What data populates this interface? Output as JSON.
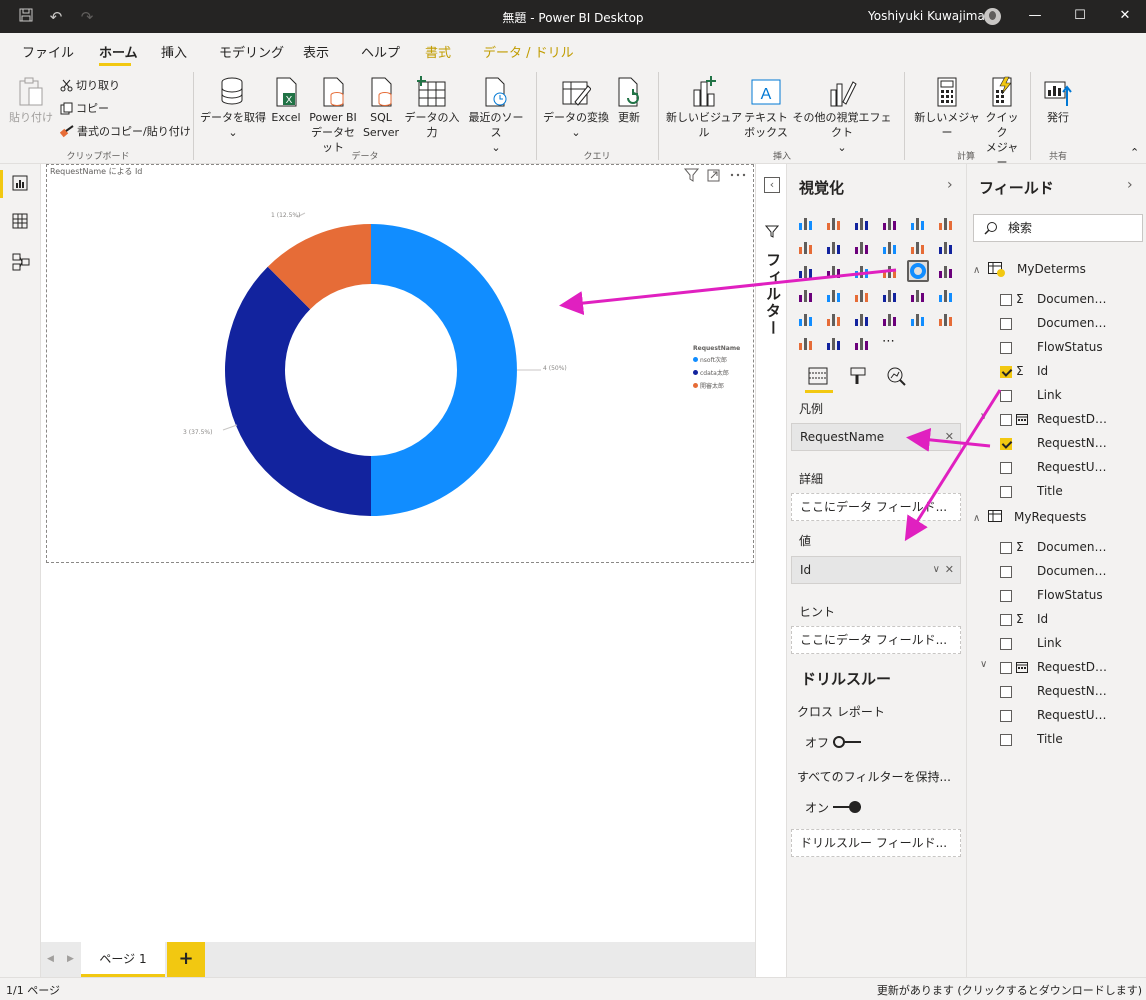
{
  "window": {
    "title": "無題 - Power BI Desktop",
    "user": "Yoshiyuki Kuwajima"
  },
  "menu_tabs": [
    {
      "label": "ファイル",
      "state": "normal"
    },
    {
      "label": "ホーム",
      "state": "active"
    },
    {
      "label": "挿入",
      "state": "normal"
    },
    {
      "label": "モデリング",
      "state": "normal"
    },
    {
      "label": "表示",
      "state": "normal"
    },
    {
      "label": "ヘルプ",
      "state": "normal"
    },
    {
      "label": "書式",
      "state": "context"
    },
    {
      "label": "データ / ドリル",
      "state": "context"
    }
  ],
  "ribbon": {
    "clipboard": {
      "paste": "貼り付け",
      "cut": "切り取り",
      "copy": "コピー",
      "format_painter": "書式のコピー/貼り付け",
      "group": "クリップボード"
    },
    "data": {
      "get_data": "データを取得",
      "excel": "Excel",
      "pbi_1": "Power BI",
      "pbi_2": "データセット",
      "sql_1": "SQL",
      "sql_2": "Server",
      "enter_data": "データの入力",
      "recent": "最近のソース",
      "group": "データ"
    },
    "query": {
      "transform": "データの変換",
      "refresh": "更新",
      "group": "クエリ"
    },
    "insert": {
      "new_visual": "新しいビジュアル",
      "textbox_1": "テキスト",
      "textbox_2": "ボックス",
      "more_visuals": "その他の視覚エフェクト",
      "group": "挿入"
    },
    "calc": {
      "new_measure": "新しいメジャー",
      "quick_1": "クイック",
      "quick_2": "メジャー",
      "group": "計算"
    },
    "share": {
      "publish": "発行",
      "group": "共有"
    }
  },
  "visual": {
    "title": "RequestName による Id",
    "legend_title": "RequestName",
    "legend": [
      {
        "label": "nsoft次郎",
        "color": "#118DFF"
      },
      {
        "label": "cdata太郎",
        "color": "#12239E"
      },
      {
        "label": "開審太郎",
        "color": "#E66C37"
      }
    ],
    "labels": {
      "slice_a": "4 (50%)",
      "slice_b": "3 (37.5%)",
      "slice_c": "1 (12.5%)"
    }
  },
  "chart_data": {
    "type": "pie",
    "categories": [
      "nsoft次郎",
      "cdata太郎",
      "開審太郎"
    ],
    "values": [
      4,
      3,
      1
    ],
    "colors": [
      "#118DFF",
      "#12239E",
      "#E66C37"
    ],
    "title": "RequestName による Id",
    "legend_title": "RequestName",
    "legend_position": "right",
    "donut": true
  },
  "pages": {
    "current": "ページ 1",
    "add": "+"
  },
  "filter_pane": {
    "label": "フィルター"
  },
  "viz_pane": {
    "title": "視覚化",
    "wells": {
      "legend_label": "凡例",
      "legend_value": "RequestName",
      "details_label": "詳細",
      "details_placeholder": "ここにデータ フィールド...",
      "values_label": "値",
      "values_value": "Id",
      "tooltips_label": "ヒント",
      "tooltips_placeholder": "ここにデータ フィールド..."
    },
    "drillthrough": {
      "title": "ドリルスルー",
      "cross_report": "クロス レポート",
      "cross_report_state": "オフ",
      "keep_filters": "すべてのフィルターを保持...",
      "keep_filters_state": "オン",
      "placeholder": "ドリルスルー フィールド..."
    }
  },
  "fields_pane": {
    "title": "フィールド",
    "search_placeholder": "検索",
    "tables": [
      {
        "name": "MyDeterms",
        "fields": [
          {
            "name": "DocumentId",
            "checked": false,
            "type": "sigma"
          },
          {
            "name": "Document...",
            "checked": false,
            "type": "text"
          },
          {
            "name": "FlowStatus",
            "checked": false,
            "type": "text"
          },
          {
            "name": "Id",
            "checked": true,
            "type": "sigma"
          },
          {
            "name": "Link",
            "checked": false,
            "type": "text"
          },
          {
            "name": "RequestDate",
            "checked": false,
            "type": "date"
          },
          {
            "name": "RequestNa...",
            "checked": true,
            "type": "text"
          },
          {
            "name": "RequestUse...",
            "checked": false,
            "type": "text"
          },
          {
            "name": "Title",
            "checked": false,
            "type": "text"
          }
        ]
      },
      {
        "name": "MyRequests",
        "fields": [
          {
            "name": "DocumentId",
            "checked": false,
            "type": "sigma"
          },
          {
            "name": "Document...",
            "checked": false,
            "type": "text"
          },
          {
            "name": "FlowStatus",
            "checked": false,
            "type": "text"
          },
          {
            "name": "Id",
            "checked": false,
            "type": "sigma"
          },
          {
            "name": "Link",
            "checked": false,
            "type": "text"
          },
          {
            "name": "RequestDate",
            "checked": false,
            "type": "date"
          },
          {
            "name": "RequestNa...",
            "checked": false,
            "type": "text"
          },
          {
            "name": "RequestUse...",
            "checked": false,
            "type": "text"
          },
          {
            "name": "Title",
            "checked": false,
            "type": "text"
          }
        ]
      }
    ]
  },
  "status": {
    "pages": "1/1 ページ",
    "update": "更新があります (クリックするとダウンロードします)"
  },
  "colors": {
    "accent": "#F2C811",
    "annotation_arrow": "#E020C0"
  }
}
